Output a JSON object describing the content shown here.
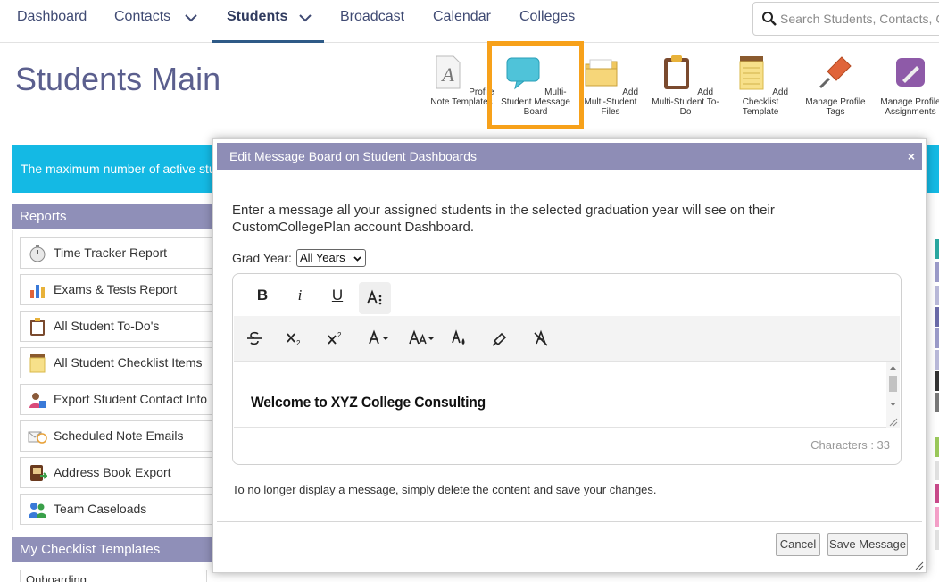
{
  "nav": {
    "items": [
      "Dashboard",
      "Contacts",
      "Students",
      "Broadcast",
      "Calendar",
      "Colleges"
    ],
    "active": "Students",
    "search_placeholder": "Search Students, Contacts, Colleges"
  },
  "page": {
    "title": "Students Main"
  },
  "toolbar": [
    {
      "label": "Profile Note Templates",
      "icon": "profile-note-template-icon"
    },
    {
      "label": "Multi-Student Message Board",
      "icon": "message-board-icon",
      "highlighted": true
    },
    {
      "label": "Add Multi-Student Files",
      "icon": "folder-icon"
    },
    {
      "label": "Add Multi-Student To-Do",
      "icon": "clipboard-icon"
    },
    {
      "label": "Add Checklist Template",
      "icon": "notepad-icon"
    },
    {
      "label": "Manage Profile Tags",
      "icon": "pin-icon"
    },
    {
      "label": "Manage Profile Assignments",
      "icon": "assignments-icon"
    }
  ],
  "banner": {
    "text": "The maximum number of active stu"
  },
  "reports": {
    "heading": "Reports",
    "items": [
      {
        "label": "Time Tracker Report",
        "icon": "stopwatch-icon"
      },
      {
        "label": "Exams & Tests Report",
        "icon": "bar-chart-icon"
      },
      {
        "label": "All Student To-Do's",
        "icon": "clipboard-icon"
      },
      {
        "label": "All Student Checklist Items",
        "icon": "notepad-icon"
      },
      {
        "label": "Export Student Contact Info",
        "icon": "contact-export-icon"
      },
      {
        "label": "Scheduled Note Emails",
        "icon": "scheduled-email-icon"
      },
      {
        "label": "Address Book Export",
        "icon": "address-book-icon"
      },
      {
        "label": "Team Caseloads",
        "icon": "team-icon"
      }
    ]
  },
  "checklist_templates": {
    "heading": "My Checklist Templates",
    "first_item": "Onboarding"
  },
  "modal": {
    "title": "Edit Message Board on Student Dashboards",
    "close_glyph": "×",
    "description": "Enter a message all your assigned students in the selected graduation year will see on their CustomCollegePlan account Dashboard.",
    "grad_year_label": "Grad Year:",
    "grad_year_value": "All Years",
    "editor": {
      "bold": "B",
      "italic": "i",
      "underline": "U",
      "content": "Welcome to XYZ College Consulting",
      "char_count": "Characters : 33"
    },
    "note": "To no longer display a message, simply delete the content and save your changes.",
    "cancel_label": "Cancel",
    "save_label": "Save Message"
  },
  "colors": {
    "nav_text": "#3f4a73",
    "title": "#5b5f8e",
    "banner": "#14b9e4",
    "section_head": "#8f8fb8",
    "modal_head": "#8e8db6",
    "highlight": "#f7a11a"
  }
}
